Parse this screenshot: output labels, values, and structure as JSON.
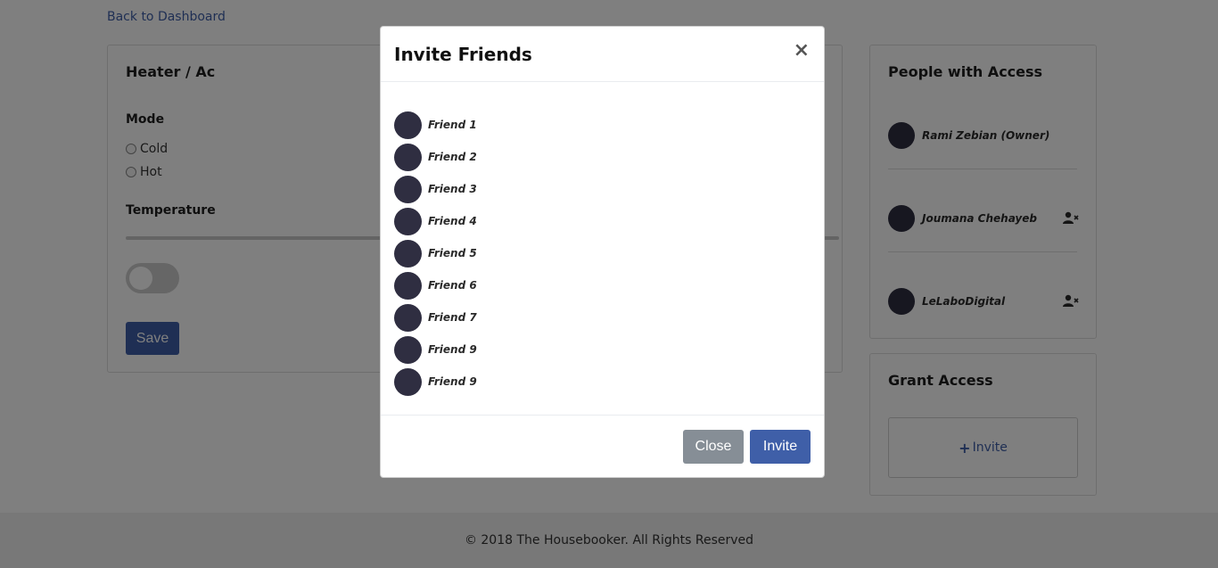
{
  "nav": {
    "back_link": "Back to Dashboard"
  },
  "device": {
    "title": "Heater / Ac",
    "mode_label": "Mode",
    "modes": [
      "Cold",
      "Hot"
    ],
    "temperature_label": "Temperature",
    "toggle_on": false,
    "save_label": "Save"
  },
  "people": {
    "title": "People with Access",
    "items": [
      {
        "name": "Rami Zebian (Owner)",
        "removable": false
      },
      {
        "name": "Joumana Chehayeb",
        "removable": true
      },
      {
        "name": "LeLaboDigital",
        "removable": true
      }
    ]
  },
  "grant": {
    "title": "Grant Access",
    "invite_label": "Invite"
  },
  "footer": {
    "text": "© 2018 The Housebooker. All Rights Reserved"
  },
  "modal": {
    "title": "Invite Friends",
    "close_symbol": "×",
    "friends": [
      "Friend 1",
      "Friend 2",
      "Friend 3",
      "Friend 4",
      "Friend 5",
      "Friend 6",
      "Friend 7",
      "Friend 9",
      "Friend 9"
    ],
    "close_label": "Close",
    "invite_label": "Invite"
  },
  "colors": {
    "accent": "#3f5fa8",
    "avatar": "#2f2e41",
    "secondary_button": "#868e96"
  }
}
